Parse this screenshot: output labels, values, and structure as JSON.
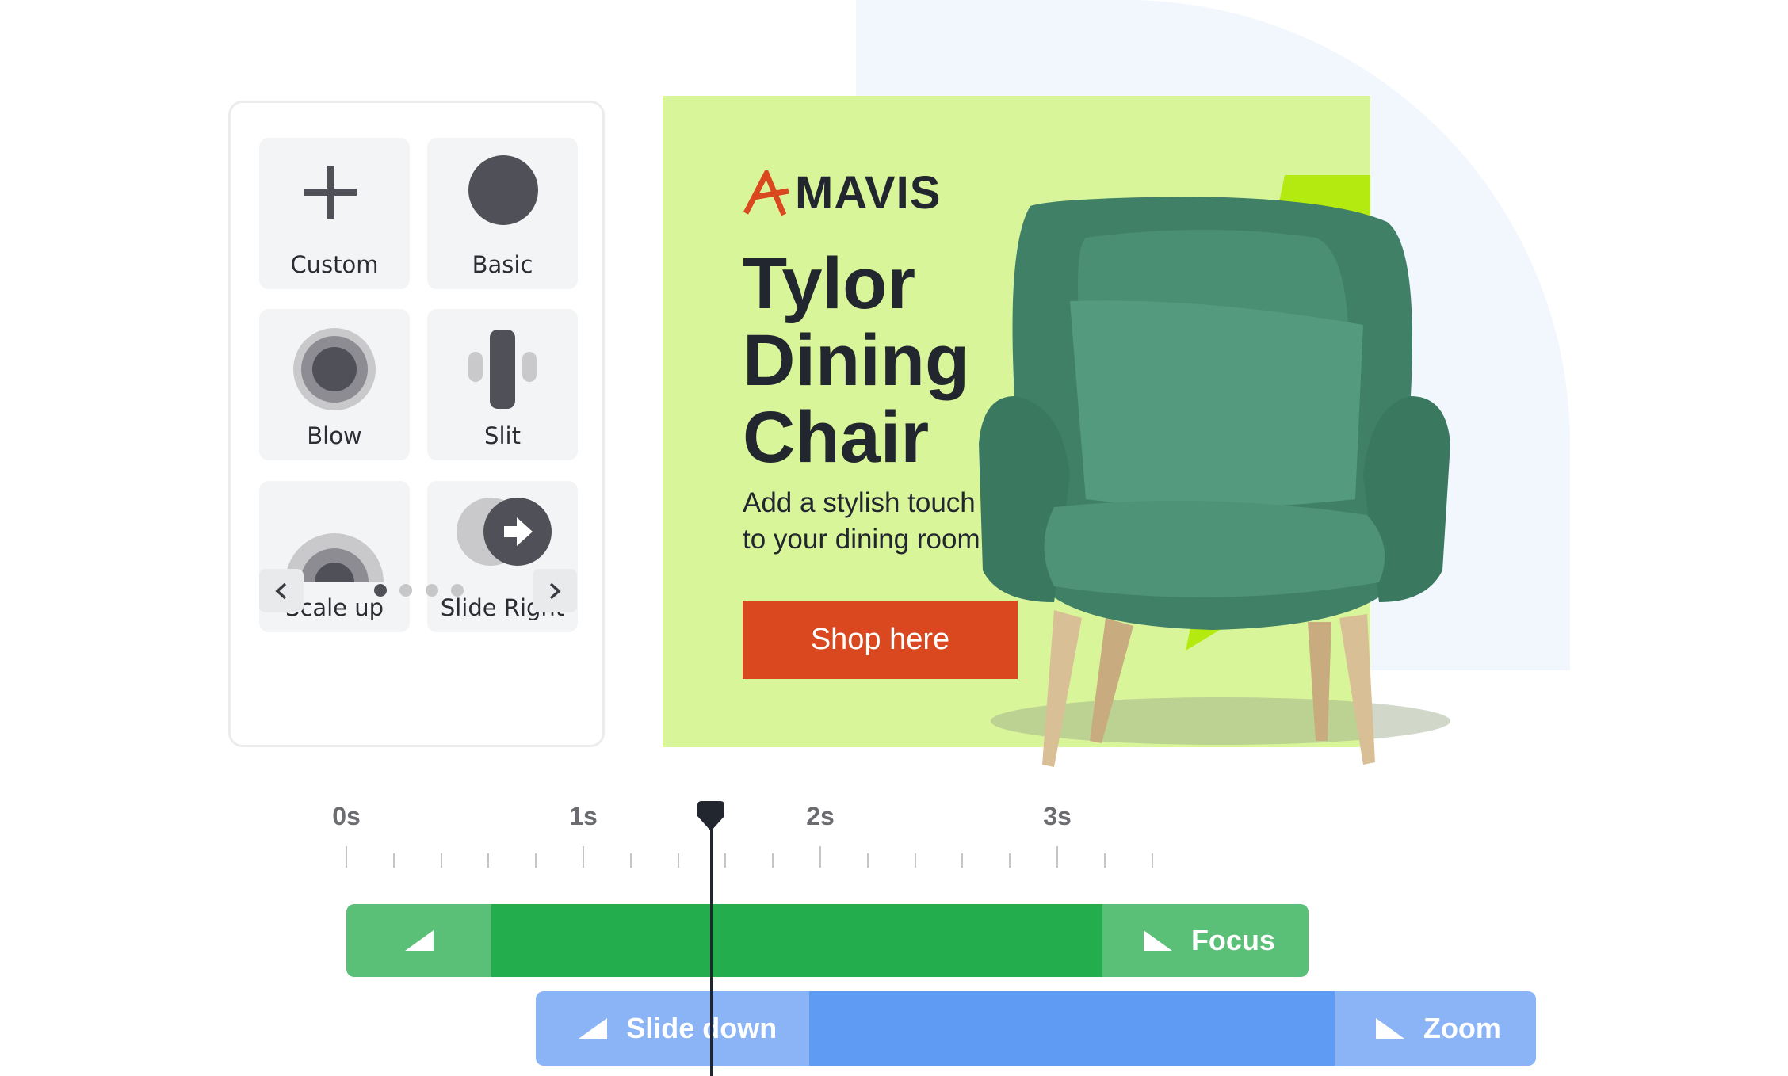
{
  "panel": {
    "tiles": [
      {
        "label": "Custom",
        "icon": "plus-icon"
      },
      {
        "label": "Basic",
        "icon": "circle-icon"
      },
      {
        "label": "Blow",
        "icon": "blow-icon"
      },
      {
        "label": "Slit",
        "icon": "slit-icon"
      },
      {
        "label": "Scale up",
        "icon": "scale-up-icon"
      },
      {
        "label": "Slide Right",
        "icon": "slide-right-icon"
      }
    ],
    "pagination": {
      "current": 1,
      "total": 4
    }
  },
  "ad": {
    "brand": "MAVIS",
    "title_lines": [
      "Tylor",
      "Dining",
      "Chair"
    ],
    "subtitle_lines": [
      "Add a stylish touch",
      "to your dining room"
    ],
    "cta": "Shop here",
    "colors": {
      "background": "#d9f59a",
      "accent": "#d9481f",
      "lime": "#b5ea10",
      "text": "#22262e"
    }
  },
  "timeline": {
    "ticks_labels": [
      "0s",
      "1s",
      "2s",
      "3s"
    ],
    "playhead_seconds": 1.54,
    "tracks": [
      {
        "in_label": "",
        "out_label": "Focus",
        "start": 0,
        "end": 4.06,
        "color": "#24ad4c",
        "edge_color": "#5bc077"
      },
      {
        "in_label": "Slide down",
        "out_label": "Zoom",
        "start": 0.8,
        "end": 5.02,
        "color": "#5f9bf3",
        "edge_color": "#8ab4f6"
      }
    ]
  }
}
